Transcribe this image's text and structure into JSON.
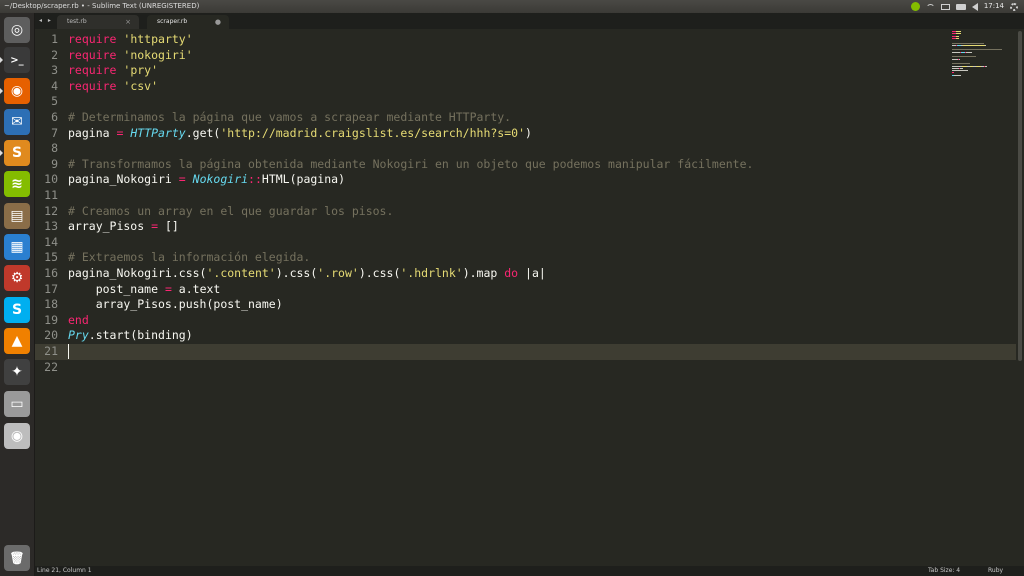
{
  "window": {
    "title": "~/Desktop/scraper.rb • - Sublime Text (UNREGISTERED)"
  },
  "tray": {
    "clock": "17:14",
    "icons": [
      "spotify-icon",
      "wifi-icon",
      "mail-icon",
      "battery-icon",
      "volume-icon",
      "gear-icon"
    ]
  },
  "launcher": {
    "items": [
      {
        "name": "ubuntu-dash-icon",
        "color": "#5e5e5e",
        "glyph": "◎"
      },
      {
        "name": "terminal-icon",
        "color": "#3a3a3a",
        "glyph": ">_"
      },
      {
        "name": "firefox-icon",
        "color": "#e66000",
        "glyph": "◉"
      },
      {
        "name": "thunderbird-icon",
        "color": "#2d6fb5",
        "glyph": "✉"
      },
      {
        "name": "sublime-text-icon",
        "color": "#e08a1e",
        "glyph": "S"
      },
      {
        "name": "spotify-icon",
        "color": "#84bd00",
        "glyph": "≋"
      },
      {
        "name": "files-icon",
        "color": "#8a6d48",
        "glyph": "▤"
      },
      {
        "name": "libreoffice-writer-icon",
        "color": "#2a7fd0",
        "glyph": "▦"
      },
      {
        "name": "system-settings-icon",
        "color": "#c0392b",
        "glyph": "⚙"
      },
      {
        "name": "skype-icon",
        "color": "#00aff0",
        "glyph": "S"
      },
      {
        "name": "vlc-icon",
        "color": "#f08000",
        "glyph": "▲"
      },
      {
        "name": "inkscape-icon",
        "color": "#404040",
        "glyph": "✦"
      },
      {
        "name": "drive-icon",
        "color": "#9a9a9a",
        "glyph": "▭"
      },
      {
        "name": "dvd-icon",
        "color": "#bdbdbd",
        "glyph": "◉"
      }
    ],
    "trash": {
      "name": "trash-icon",
      "color": "#6b6b6b",
      "glyph": "🗑"
    }
  },
  "tabs": [
    {
      "label": "test.rb",
      "close": "×"
    },
    {
      "label": "scraper.rb",
      "close": "●"
    }
  ],
  "nav_arrows": "◂ ▸",
  "editor": {
    "current_line": 21,
    "lines": [
      [
        [
          "k",
          "require"
        ],
        [
          "p",
          " "
        ],
        [
          "s",
          "'httparty'"
        ]
      ],
      [
        [
          "k",
          "require"
        ],
        [
          "p",
          " "
        ],
        [
          "s",
          "'nokogiri'"
        ]
      ],
      [
        [
          "k",
          "require"
        ],
        [
          "p",
          " "
        ],
        [
          "s",
          "'pry'"
        ]
      ],
      [
        [
          "k",
          "require"
        ],
        [
          "p",
          " "
        ],
        [
          "s",
          "'csv'"
        ]
      ],
      [],
      [
        [
          "c",
          "# Determinamos la página que vamos a scrapear mediante HTTParty."
        ]
      ],
      [
        [
          "p",
          "pagina "
        ],
        [
          "op",
          "="
        ],
        [
          "p",
          " "
        ],
        [
          "cl",
          "HTTParty"
        ],
        [
          "p",
          ".get("
        ],
        [
          "s",
          "'http://madrid.craigslist.es/search/hhh?s=0'"
        ],
        [
          "p",
          ")"
        ]
      ],
      [],
      [
        [
          "c",
          "# Transformamos la página obtenida mediante Nokogiri en un objeto que podemos manipular fácilmente."
        ]
      ],
      [
        [
          "p",
          "pagina_Nokogiri "
        ],
        [
          "op",
          "="
        ],
        [
          "p",
          " "
        ],
        [
          "cl",
          "Nokogiri"
        ],
        [
          "op",
          "::"
        ],
        [
          "p",
          "HTML(pagina)"
        ]
      ],
      [],
      [
        [
          "c",
          "# Creamos un array en el que guardar los pisos."
        ]
      ],
      [
        [
          "p",
          "array_Pisos "
        ],
        [
          "op",
          "="
        ],
        [
          "p",
          " []"
        ]
      ],
      [],
      [
        [
          "c",
          "# Extraemos la información elegida."
        ]
      ],
      [
        [
          "p",
          "pagina_Nokogiri.css("
        ],
        [
          "s",
          "'.content'"
        ],
        [
          "p",
          ").css("
        ],
        [
          "s",
          "'.row'"
        ],
        [
          "p",
          ").css("
        ],
        [
          "s",
          "'.hdrlnk'"
        ],
        [
          "p",
          ").map "
        ],
        [
          "k",
          "do"
        ],
        [
          "p",
          " |a|"
        ]
      ],
      [
        [
          "p",
          "    post_name "
        ],
        [
          "op",
          "="
        ],
        [
          "p",
          " a.text"
        ]
      ],
      [
        [
          "p",
          "    array_Pisos.push(post_name)"
        ]
      ],
      [
        [
          "k",
          "end"
        ]
      ],
      [
        [
          "cl",
          "Pry"
        ],
        [
          "p",
          ".start(binding)"
        ]
      ],
      [],
      []
    ]
  },
  "status": {
    "position": "Line 21, Column 1",
    "tab_size": "Tab Size: 4",
    "syntax": "Ruby"
  }
}
